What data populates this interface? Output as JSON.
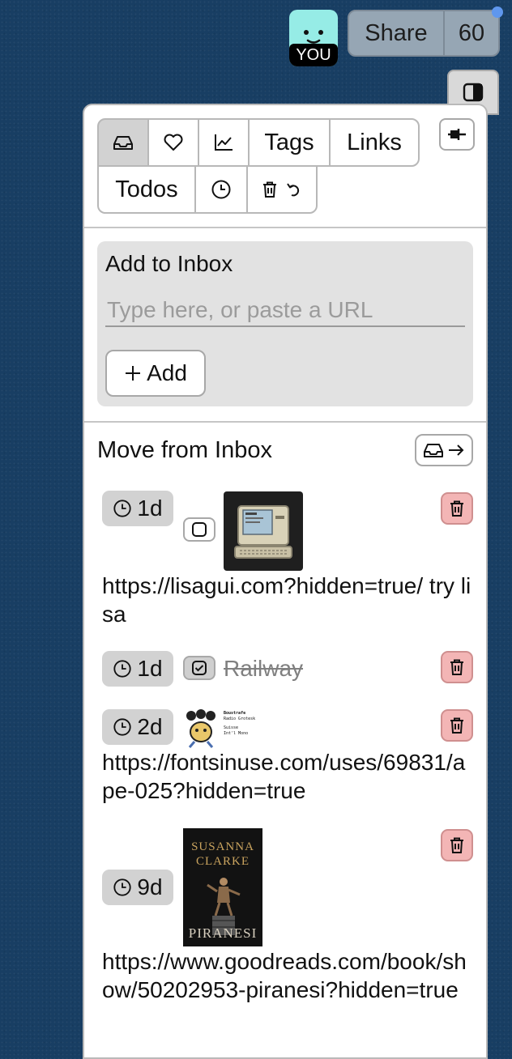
{
  "header": {
    "avatar_label": "YOU",
    "share_label": "Share",
    "share_count": "60"
  },
  "tabs": [
    {
      "icon": "inbox-icon",
      "label": ""
    },
    {
      "icon": "heart-icon",
      "label": ""
    },
    {
      "icon": "chart-icon",
      "label": ""
    },
    {
      "icon": "",
      "label": "Tags"
    },
    {
      "icon": "",
      "label": "Links"
    },
    {
      "icon": "",
      "label": "Todos"
    },
    {
      "icon": "clock-icon",
      "label": ""
    },
    {
      "icon": "trash-undo-icon",
      "label": ""
    }
  ],
  "inbox": {
    "title": "Add to Inbox",
    "placeholder": "Type here, or paste a URL",
    "value": "",
    "add_label": "Add"
  },
  "move": {
    "title": "Move from Inbox"
  },
  "items": [
    {
      "age": "1d",
      "checked": false,
      "thumb": "retro computer icon",
      "url": "https://lisagui.com?hidden=true/ try lisa"
    },
    {
      "age": "1d",
      "checked": true,
      "title": "Railway"
    },
    {
      "age": "2d",
      "thumb": "font specimen card",
      "thumb_text": [
        "Boustrafe",
        "Radio Grotesk",
        "Suisse",
        "Int'l Mono"
      ],
      "url": "https://fontsinuse.com/uses/69831/ape-025?hidden=true"
    },
    {
      "age": "9d",
      "thumb": "book cover",
      "thumb_text": [
        "SUSANNA",
        "CLARKE",
        "PIRANESI"
      ],
      "url": "https://www.goodreads.com/book/show/50202953-piranesi?hidden=true"
    }
  ],
  "colors": {
    "background": "#183e63",
    "avatar": "#96ece6",
    "notify_dot": "#5f97ee",
    "delete_button": "#f3b5b5",
    "active_tab": "#d2d2d2"
  }
}
